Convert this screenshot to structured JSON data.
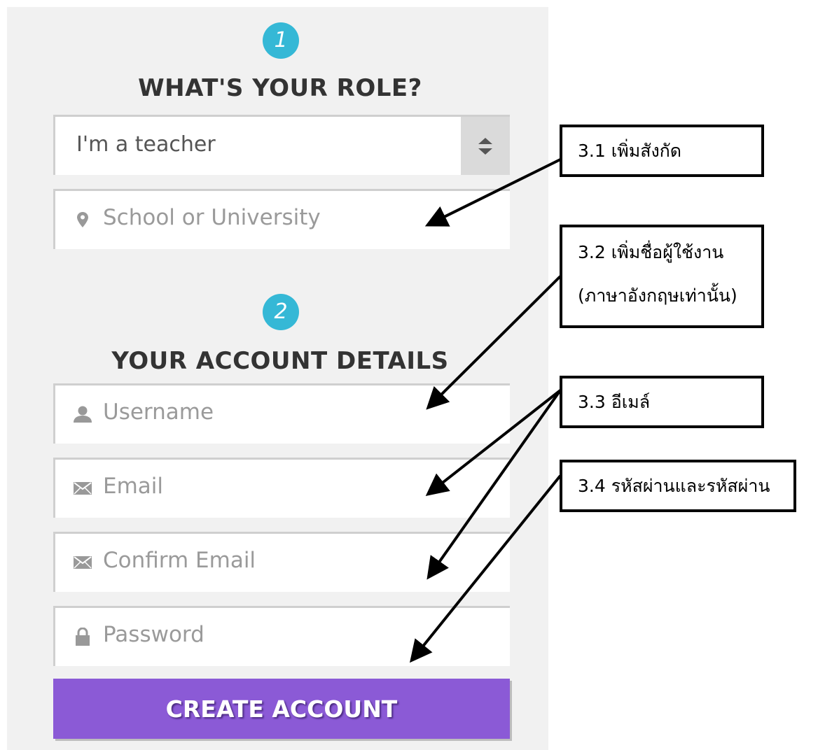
{
  "step1": {
    "number": "1",
    "heading": "WHAT'S YOUR ROLE?"
  },
  "role_select": {
    "value": "I'm a teacher"
  },
  "school": {
    "placeholder": "School or University",
    "icon": "map-marker-icon"
  },
  "step2": {
    "number": "2",
    "heading": "YOUR ACCOUNT DETAILS"
  },
  "fields": {
    "username": {
      "placeholder": "Username",
      "icon": "user-icon"
    },
    "email": {
      "placeholder": "Email",
      "icon": "envelope-icon"
    },
    "confirm_email": {
      "placeholder": "Confirm Email",
      "icon": "envelope-icon"
    },
    "password": {
      "placeholder": "Password",
      "icon": "lock-icon"
    }
  },
  "create_button": {
    "label": "CREATE ACCOUNT"
  },
  "annotations": {
    "a1": "3.1 เพิ่มสังกัด",
    "a2_line1": "3.2  เพิ่มชื่อผู้ใช้งาน",
    "a2_line2": "(ภาษาอังกฤษเท่านั้น)",
    "a3": "3.3  อีเมล์",
    "a4": "3.4  รหัสผ่านและรหัสผ่าน"
  },
  "colors": {
    "accent": "#35b8d6",
    "button": "#8b5ad6",
    "panel": "#f1f1f1"
  }
}
